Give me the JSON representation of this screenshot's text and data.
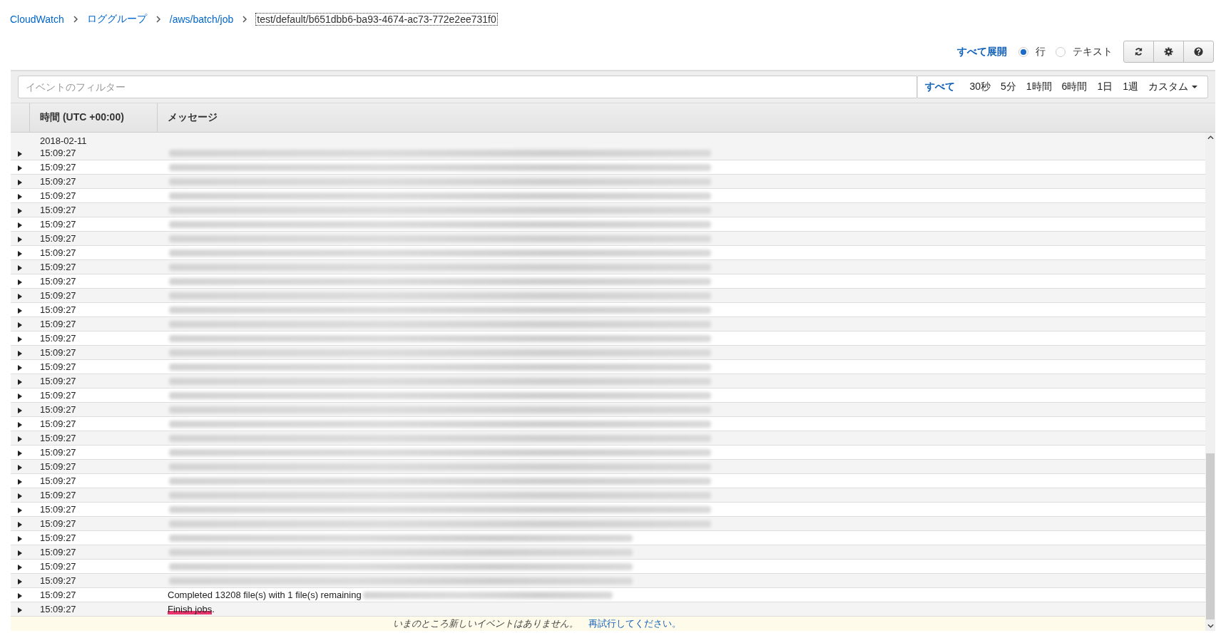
{
  "breadcrumb": [
    {
      "label": "CloudWatch",
      "kind": "link"
    },
    {
      "label": "ロググループ",
      "kind": "link"
    },
    {
      "label": "/aws/batch/job",
      "kind": "link"
    },
    {
      "label": "test/default/b651dbb6-ba93-4674-ac73-772e2ee731f0",
      "kind": "current"
    }
  ],
  "toolbar": {
    "expand_all": "すべて展開",
    "view_modes": [
      {
        "label": "行",
        "selected": true
      },
      {
        "label": "テキスト",
        "selected": false
      }
    ],
    "buttons": [
      {
        "kind": "refresh"
      },
      {
        "kind": "settings"
      },
      {
        "kind": "help"
      }
    ]
  },
  "filter": {
    "placeholder": "イベントのフィルター",
    "ranges": [
      {
        "label": "すべて",
        "selected": true
      },
      {
        "label": "30秒",
        "selected": false
      },
      {
        "label": "5分",
        "selected": false
      },
      {
        "label": "1時間",
        "selected": false
      },
      {
        "label": "6時間",
        "selected": false
      },
      {
        "label": "1日",
        "selected": false
      },
      {
        "label": "1週",
        "selected": false
      }
    ],
    "custom": "カスタム"
  },
  "table": {
    "columns": [
      "時間 (UTC +00:00)",
      "メッセージ"
    ],
    "date": "2018-02-11",
    "rows": [
      {
        "time": "15:09:27",
        "kind": "long"
      },
      {
        "time": "15:09:27",
        "kind": "long"
      },
      {
        "time": "15:09:27",
        "kind": "long"
      },
      {
        "time": "15:09:27",
        "kind": "long"
      },
      {
        "time": "15:09:27",
        "kind": "long"
      },
      {
        "time": "15:09:27",
        "kind": "long"
      },
      {
        "time": "15:09:27",
        "kind": "long"
      },
      {
        "time": "15:09:27",
        "kind": "long"
      },
      {
        "time": "15:09:27",
        "kind": "long"
      },
      {
        "time": "15:09:27",
        "kind": "long"
      },
      {
        "time": "15:09:27",
        "kind": "long"
      },
      {
        "time": "15:09:27",
        "kind": "long"
      },
      {
        "time": "15:09:27",
        "kind": "long"
      },
      {
        "time": "15:09:27",
        "kind": "long"
      },
      {
        "time": "15:09:27",
        "kind": "long"
      },
      {
        "time": "15:09:27",
        "kind": "long"
      },
      {
        "time": "15:09:27",
        "kind": "long"
      },
      {
        "time": "15:09:27",
        "kind": "long"
      },
      {
        "time": "15:09:27",
        "kind": "long"
      },
      {
        "time": "15:09:27",
        "kind": "long"
      },
      {
        "time": "15:09:27",
        "kind": "long"
      },
      {
        "time": "15:09:27",
        "kind": "long"
      },
      {
        "time": "15:09:27",
        "kind": "long"
      },
      {
        "time": "15:09:27",
        "kind": "long"
      },
      {
        "time": "15:09:27",
        "kind": "long"
      },
      {
        "time": "15:09:27",
        "kind": "long"
      },
      {
        "time": "15:09:27",
        "kind": "long"
      },
      {
        "time": "15:09:27",
        "kind": "short"
      },
      {
        "time": "15:09:27",
        "kind": "short"
      },
      {
        "time": "15:09:27",
        "kind": "short"
      },
      {
        "time": "15:09:27",
        "kind": "short"
      },
      {
        "time": "15:09:27",
        "kind": "tail",
        "message": [
          {
            "text": "Completed 13208 file(s) with 1 file(s) remaining",
            "marked": false
          }
        ]
      },
      {
        "time": "15:09:27",
        "kind": "plain",
        "message": [
          {
            "text": "Finish jobs",
            "marked": true
          },
          {
            "text": ".",
            "marked": false
          }
        ]
      }
    ]
  },
  "footer": {
    "notice": "いまのところ新しいイベントはありません。",
    "retry": "再試行してください。"
  }
}
